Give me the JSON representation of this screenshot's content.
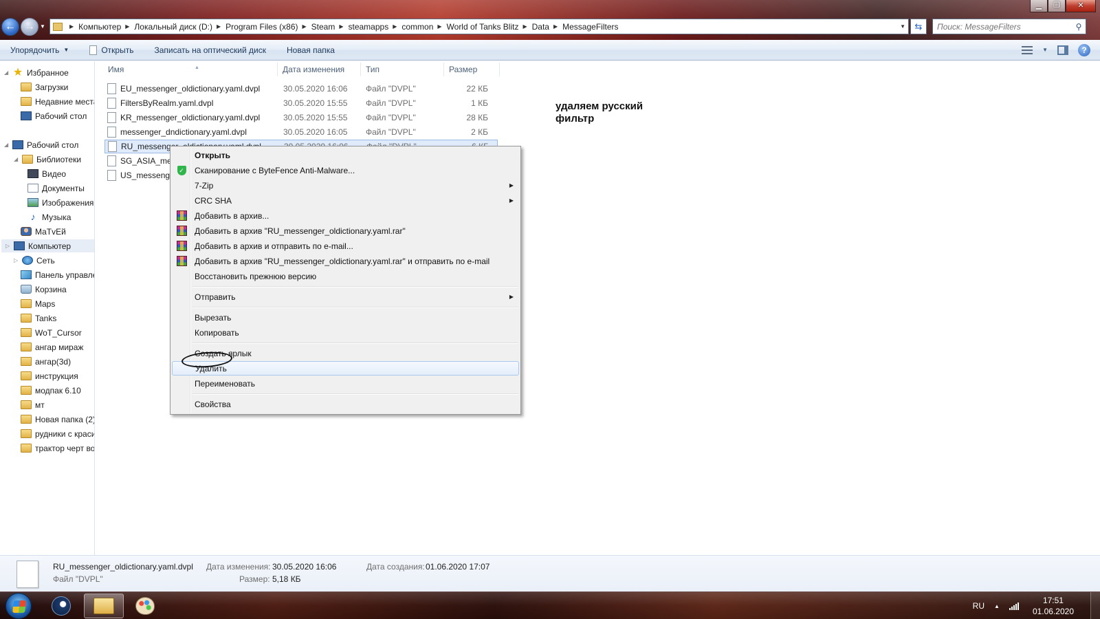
{
  "window": {
    "address_crumbs": [
      "Компьютер",
      "Локальный диск (D:)",
      "Program Files (x86)",
      "Steam",
      "steamapps",
      "common",
      "World of Tanks Blitz",
      "Data",
      "MessageFilters"
    ],
    "search_placeholder": "Поиск: MessageFilters",
    "buttons": {
      "minimize": "▁",
      "maximize": "❐",
      "close": "✕"
    }
  },
  "toolbar": {
    "organize": "Упорядочить",
    "open": "Открыть",
    "burn": "Записать на оптический диск",
    "new_folder": "Новая папка",
    "help": "?"
  },
  "sidebar": {
    "items": [
      {
        "label": "Избранное",
        "icon": "star-icon"
      },
      {
        "label": "Загрузки",
        "icon": "downloads-folder-icon"
      },
      {
        "label": "Недавние места",
        "icon": "recent-places-icon"
      },
      {
        "label": "Рабочий стол",
        "icon": "desktop-icon"
      },
      {
        "label": "Рабочий стол",
        "icon": "desktop-icon"
      },
      {
        "label": "Библиотеки",
        "icon": "libraries-icon"
      },
      {
        "label": "Видео",
        "icon": "video-icon"
      },
      {
        "label": "Документы",
        "icon": "documents-icon"
      },
      {
        "label": "Изображения",
        "icon": "pictures-icon"
      },
      {
        "label": "Музыка",
        "icon": "music-icon"
      },
      {
        "label": "МаТvЕй",
        "icon": "user-icon"
      },
      {
        "label": "Компьютер",
        "icon": "computer-icon"
      },
      {
        "label": "Сеть",
        "icon": "network-icon"
      },
      {
        "label": "Панель управления",
        "icon": "control-panel-icon"
      },
      {
        "label": "Корзина",
        "icon": "recycle-bin-icon"
      },
      {
        "label": "Maps",
        "icon": "folder-icon"
      },
      {
        "label": "Tanks",
        "icon": "folder-icon"
      },
      {
        "label": "WoT_Cursor",
        "icon": "folder-icon"
      },
      {
        "label": "ангар мираж",
        "icon": "folder-icon"
      },
      {
        "label": "ангар(3d)",
        "icon": "folder-icon"
      },
      {
        "label": "инструкция",
        "icon": "folder-icon"
      },
      {
        "label": "модпак 6.10",
        "icon": "folder-icon"
      },
      {
        "label": "мт",
        "icon": "folder-icon"
      },
      {
        "label": "Новая папка (2)",
        "icon": "folder-icon"
      },
      {
        "label": "рудники с красивым",
        "icon": "folder-icon"
      },
      {
        "label": "трактор черт во",
        "icon": "folder-icon"
      }
    ]
  },
  "columns": {
    "name": "Имя",
    "date": "Дата изменения",
    "type": "Тип",
    "size": "Размер"
  },
  "files": [
    {
      "name": "EU_messenger_oldictionary.yaml.dvpl",
      "date": "30.05.2020 16:06",
      "type": "Файл \"DVPL\"",
      "size": "22 КБ"
    },
    {
      "name": "FiltersByRealm.yaml.dvpl",
      "date": "30.05.2020 15:55",
      "type": "Файл \"DVPL\"",
      "size": "1 КБ"
    },
    {
      "name": "KR_messenger_oldictionary.yaml.dvpl",
      "date": "30.05.2020 15:55",
      "type": "Файл \"DVPL\"",
      "size": "28 КБ"
    },
    {
      "name": "messenger_dndictionary.yaml.dvpl",
      "date": "30.05.2020 16:05",
      "type": "Файл \"DVPL\"",
      "size": "2 КБ"
    },
    {
      "name": "RU_messenger_oldictionary.yaml.dvpl",
      "date": "30.05.2020 16:06",
      "type": "Файл \"DVPL\"",
      "size": "6 КБ"
    },
    {
      "name": "SG_ASIA_messenger_oldictionary.yaml.dvpl",
      "date": "",
      "type": "",
      "size": ""
    },
    {
      "name": "US_messenger_oldictionary.yaml.dvpl",
      "date": "",
      "type": "",
      "size": ""
    }
  ],
  "annotation": "удаляем русский фильтр",
  "context_menu": {
    "items": [
      {
        "label": "Открыть",
        "bold": true
      },
      {
        "label": "Сканирование с ByteFence Anti-Malware...",
        "icon": "bytefence-shield-icon"
      },
      {
        "label": "7-Zip",
        "submenu": true
      },
      {
        "label": "CRC SHA",
        "submenu": true
      },
      {
        "label": "Добавить в архив...",
        "icon": "winrar-icon"
      },
      {
        "label": "Добавить в архив \"RU_messenger_oldictionary.yaml.rar\"",
        "icon": "winrar-icon"
      },
      {
        "label": "Добавить в архив и отправить по e-mail...",
        "icon": "winrar-icon"
      },
      {
        "label": "Добавить в архив \"RU_messenger_oldictionary.yaml.rar\" и отправить по e-mail",
        "icon": "winrar-icon"
      },
      {
        "label": "Восстановить прежнюю версию"
      },
      {
        "label": "Отправить",
        "submenu": true
      },
      {
        "label": "Вырезать"
      },
      {
        "label": "Копировать"
      },
      {
        "label": "Создать ярлык"
      },
      {
        "label": "Удалить",
        "highlighted": true
      },
      {
        "label": "Переименовать"
      },
      {
        "label": "Свойства"
      }
    ]
  },
  "details": {
    "name": "RU_messenger_oldictionary.yaml.dvpl",
    "type": "Файл \"DVPL\"",
    "modified_label": "Дата изменения:",
    "modified_value": "30.05.2020 16:06",
    "size_label": "Размер:",
    "size_value": "5,18 КБ",
    "created_label": "Дата создания:",
    "created_value": "01.06.2020 17:07"
  },
  "taskbar": {
    "lang": "RU",
    "time": "17:51",
    "date": "01.06.2020"
  },
  "colors": {
    "accent": "#1e395b",
    "selection": "#dfeafa",
    "menu_bg": "#f0f0f0"
  }
}
